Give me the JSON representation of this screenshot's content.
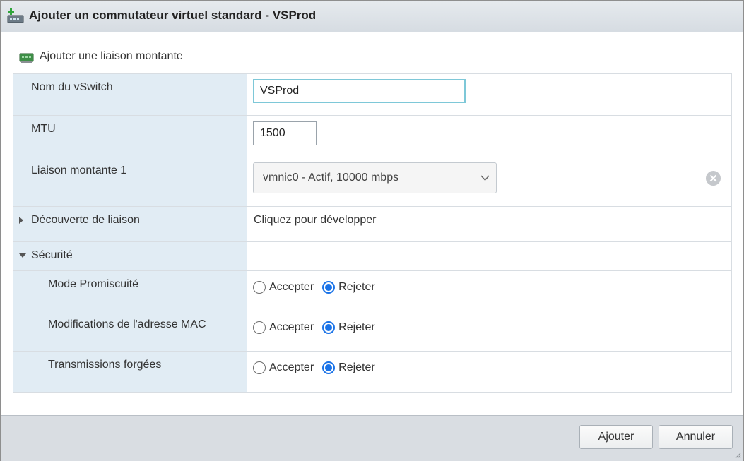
{
  "dialog": {
    "title": "Ajouter un commutateur virtuel standard - VSProd",
    "title_icon": "vswitch-add-icon"
  },
  "toolbar": {
    "add_uplink_label": "Ajouter une liaison montante",
    "add_uplink_icon": "nic-add-icon"
  },
  "form": {
    "vswitch_name": {
      "label": "Nom du vSwitch",
      "value": "VSProd"
    },
    "mtu": {
      "label": "MTU",
      "value": "1500"
    },
    "uplink1": {
      "label": "Liaison montante 1",
      "value": "vmnic0 - Actif, 10000 mbps"
    },
    "link_discovery": {
      "label": "Découverte de liaison",
      "expand_text": "Cliquez pour développer",
      "expanded": false
    },
    "security": {
      "label": "Sécurité",
      "expanded": true,
      "accept_label": "Accepter",
      "reject_label": "Rejeter",
      "promiscuous": {
        "label": "Mode Promiscuité",
        "selected": "Rejeter"
      },
      "mac_changes": {
        "label": "Modifications de l'adresse MAC",
        "selected": "Rejeter"
      },
      "forged_transmits": {
        "label": "Transmissions forgées",
        "selected": "Rejeter"
      }
    }
  },
  "footer": {
    "add_label": "Ajouter",
    "cancel_label": "Annuler"
  },
  "colors": {
    "accent": "#1a73e8",
    "label_column": "#e1ecf4",
    "focus_ring": "#7ec8d8"
  }
}
